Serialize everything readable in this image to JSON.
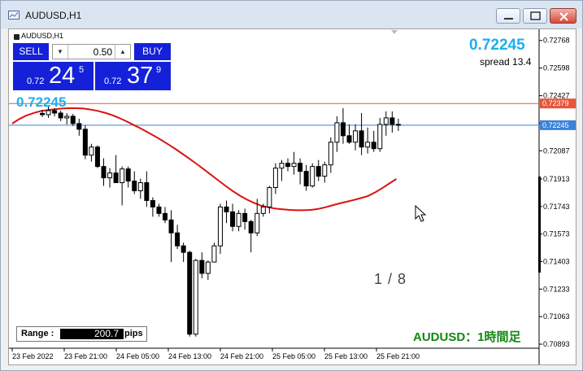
{
  "window": {
    "title": "AUDUSD,H1",
    "icon": "chart-window-icon"
  },
  "chart": {
    "symbol_label": "AUDUSD,H1",
    "trade_panel": {
      "sell_label": "SELL",
      "buy_label": "BUY",
      "lot": "0.50",
      "sell_prefix": "0.72",
      "sell_big": "24",
      "sell_sup": "5",
      "buy_prefix": "0.72",
      "buy_big": "37",
      "buy_sup": "9"
    },
    "bid_price": "0.72245",
    "spread_text": "spread 13.4",
    "price_overlay": "0.72245",
    "page_indicator": "1 / 8",
    "pair_timeframe": "AUDUSD：1時間足",
    "range": {
      "label": "Range :",
      "value": "200.7",
      "unit": "pips"
    },
    "colors": {
      "bid_line": "#3b82d9",
      "ask_line": "#e8553a",
      "ma": "#dd1111",
      "price_text": "#1ab0ef",
      "pair_text": "#118811",
      "panel_blue": "#1521d9"
    }
  },
  "chart_data": {
    "type": "candlestick",
    "y_axis_ticks": [
      "0.72768",
      "0.72598",
      "0.72427",
      "0.72257",
      "0.72087",
      "0.71913",
      "0.71743",
      "0.71573",
      "0.71403",
      "0.71233",
      "0.71063",
      "0.70893"
    ],
    "x_axis_ticks": [
      "23 Feb 2022",
      "23 Feb 21:00",
      "24 Feb 05:00",
      "24 Feb 13:00",
      "24 Feb 21:00",
      "25 Feb 05:00",
      "25 Feb 13:00",
      "25 Feb 21:00"
    ],
    "price_tags": [
      {
        "label": "0.72379",
        "value": 0.72379,
        "color": "#e8553a"
      },
      {
        "label": "0.72245",
        "value": 0.72245,
        "color": "#3b82d9"
      }
    ],
    "ylim": [
      0.70868,
      0.72827
    ],
    "candles": [
      [
        0.72318,
        0.7234,
        0.72295,
        0.7231
      ],
      [
        0.7231,
        0.72362,
        0.7229,
        0.72335
      ],
      [
        0.72335,
        0.7235,
        0.723,
        0.7232
      ],
      [
        0.7232,
        0.72335,
        0.7227,
        0.7229
      ],
      [
        0.7229,
        0.7232,
        0.7225,
        0.723
      ],
      [
        0.723,
        0.72315,
        0.7224,
        0.72255
      ],
      [
        0.72255,
        0.72285,
        0.7218,
        0.7222
      ],
      [
        0.7222,
        0.72245,
        0.72035,
        0.7206
      ],
      [
        0.7206,
        0.7213,
        0.7202,
        0.7211
      ],
      [
        0.7211,
        0.7212,
        0.7198,
        0.7199
      ],
      [
        0.7199,
        0.7204,
        0.7187,
        0.7192
      ],
      [
        0.7192,
        0.7198,
        0.7186,
        0.7195
      ],
      [
        0.7195,
        0.7206,
        0.719,
        0.7189
      ],
      [
        0.7189,
        0.7199,
        0.7175,
        0.71975
      ],
      [
        0.71975,
        0.7199,
        0.7186,
        0.719
      ],
      [
        0.719,
        0.7196,
        0.7182,
        0.7184
      ],
      [
        0.7184,
        0.71915,
        0.7179,
        0.7189
      ],
      [
        0.7189,
        0.7196,
        0.7174,
        0.7178
      ],
      [
        0.7178,
        0.718,
        0.7168,
        0.7174
      ],
      [
        0.7174,
        0.7176,
        0.7168,
        0.717
      ],
      [
        0.717,
        0.7174,
        0.7164,
        0.7166
      ],
      [
        0.7166,
        0.7172,
        0.714,
        0.7158
      ],
      [
        0.7158,
        0.7163,
        0.7148,
        0.715
      ],
      [
        0.715,
        0.7152,
        0.714,
        0.7146
      ],
      [
        0.7146,
        0.7147,
        0.7094,
        0.70955
      ],
      [
        0.70955,
        0.7142,
        0.7094,
        0.7141
      ],
      [
        0.7141,
        0.7146,
        0.713,
        0.7133
      ],
      [
        0.7133,
        0.7141,
        0.7129,
        0.714
      ],
      [
        0.714,
        0.7152,
        0.7144,
        0.715
      ],
      [
        0.715,
        0.7176,
        0.7145,
        0.7174
      ],
      [
        0.7174,
        0.7178,
        0.7164,
        0.7171
      ],
      [
        0.7171,
        0.7176,
        0.7159,
        0.7162
      ],
      [
        0.7162,
        0.7172,
        0.7159,
        0.717
      ],
      [
        0.717,
        0.7173,
        0.716,
        0.7165
      ],
      [
        0.7165,
        0.7166,
        0.7146,
        0.7158
      ],
      [
        0.7158,
        0.7179,
        0.7156,
        0.717
      ],
      [
        0.717,
        0.7176,
        0.7168,
        0.7174
      ],
      [
        0.7174,
        0.7187,
        0.717,
        0.7186
      ],
      [
        0.7186,
        0.7201,
        0.7182,
        0.7198
      ],
      [
        0.7198,
        0.7203,
        0.719,
        0.7201
      ],
      [
        0.7201,
        0.7204,
        0.7196,
        0.7199
      ],
      [
        0.7199,
        0.7208,
        0.7194,
        0.7201
      ],
      [
        0.7201,
        0.7204,
        0.7188,
        0.7196
      ],
      [
        0.7196,
        0.72,
        0.7184,
        0.7187
      ],
      [
        0.7187,
        0.7201,
        0.7186,
        0.7199
      ],
      [
        0.7199,
        0.7203,
        0.719,
        0.7193
      ],
      [
        0.7193,
        0.7202,
        0.7189,
        0.72
      ],
      [
        0.72,
        0.7217,
        0.7195,
        0.7214
      ],
      [
        0.7214,
        0.723,
        0.7208,
        0.7226
      ],
      [
        0.7226,
        0.7235,
        0.7213,
        0.7218
      ],
      [
        0.7218,
        0.7225,
        0.7213,
        0.7214
      ],
      [
        0.7214,
        0.7225,
        0.7209,
        0.7221
      ],
      [
        0.7221,
        0.7232,
        0.7206,
        0.7211
      ],
      [
        0.7211,
        0.7223,
        0.7207,
        0.7214
      ],
      [
        0.7214,
        0.7221,
        0.7208,
        0.721
      ],
      [
        0.721,
        0.7229,
        0.7208,
        0.7225
      ],
      [
        0.7225,
        0.7233,
        0.7218,
        0.7229
      ],
      [
        0.7229,
        0.7233,
        0.722,
        0.7225
      ],
      [
        0.7225,
        0.72285,
        0.7221,
        0.72245
      ]
    ],
    "ma": [
      0.72255,
      0.72283,
      0.72305,
      0.7232,
      0.72332,
      0.72339,
      0.72344,
      0.72348,
      0.7235,
      0.7235,
      0.72348,
      0.72342,
      0.72333,
      0.72322,
      0.72308,
      0.7229,
      0.7227,
      0.72248,
      0.72226,
      0.72202,
      0.72178,
      0.72152,
      0.72125,
      0.72096,
      0.72066,
      0.72035,
      0.72003,
      0.7197,
      0.71937,
      0.71903,
      0.7187,
      0.71838,
      0.7181,
      0.71785,
      0.71765,
      0.71748,
      0.71738,
      0.7173,
      0.71726,
      0.71722,
      0.7172,
      0.7172,
      0.71722,
      0.71728,
      0.71738,
      0.7175,
      0.71762,
      0.71772,
      0.71783,
      0.71795,
      0.71808,
      0.7183,
      0.71856,
      0.71885,
      0.71913
    ]
  }
}
